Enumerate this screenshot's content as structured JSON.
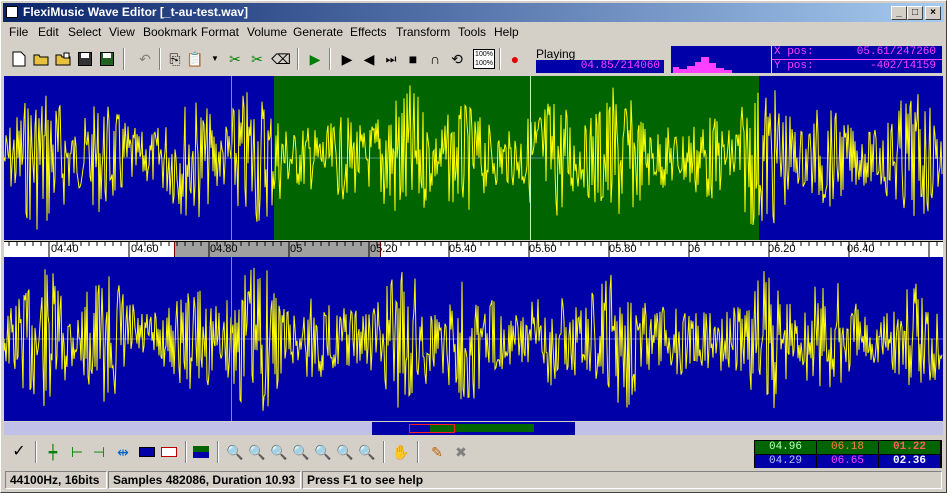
{
  "title": "FlexiMusic Wave Editor [_t-au-test.wav]",
  "window_buttons": {
    "minimize": "_",
    "maximize": "□",
    "close": "×"
  },
  "menu": [
    "File",
    "Edit",
    "Select",
    "View",
    "Bookmark",
    "Format",
    "Volume",
    "Generate",
    "Effects",
    "Transform",
    "Tools",
    "Help"
  ],
  "toolbar": {
    "zoom_100_a": "100%",
    "zoom_100_b": "100%",
    "status_label": "Playing",
    "status_position": "04.85/214060"
  },
  "position": {
    "x_label": "X pos:",
    "x_value": "05.61/247260",
    "y_label": "Y pos:",
    "y_value": "-402/14159"
  },
  "ruler": {
    "labels": [
      "04.40",
      "04.60",
      "04.80",
      "05",
      "05.20",
      "05.40",
      "05.60",
      "05.80",
      "06",
      "06.20",
      "06.40"
    ]
  },
  "colors": {
    "wave_bg": "#0000a8",
    "selection_bg": "#006400",
    "wave": "#ffff00",
    "cursor": "#ff40ff"
  },
  "time_grid": {
    "row1": [
      "04.96",
      "06.18",
      "01.22"
    ],
    "row2": [
      "04.29",
      "06.65",
      "02.36"
    ]
  },
  "status": {
    "format": "44100Hz, 16bits",
    "samples": "Samples 482086, Duration 10.93",
    "help": "Press F1 to see help"
  }
}
